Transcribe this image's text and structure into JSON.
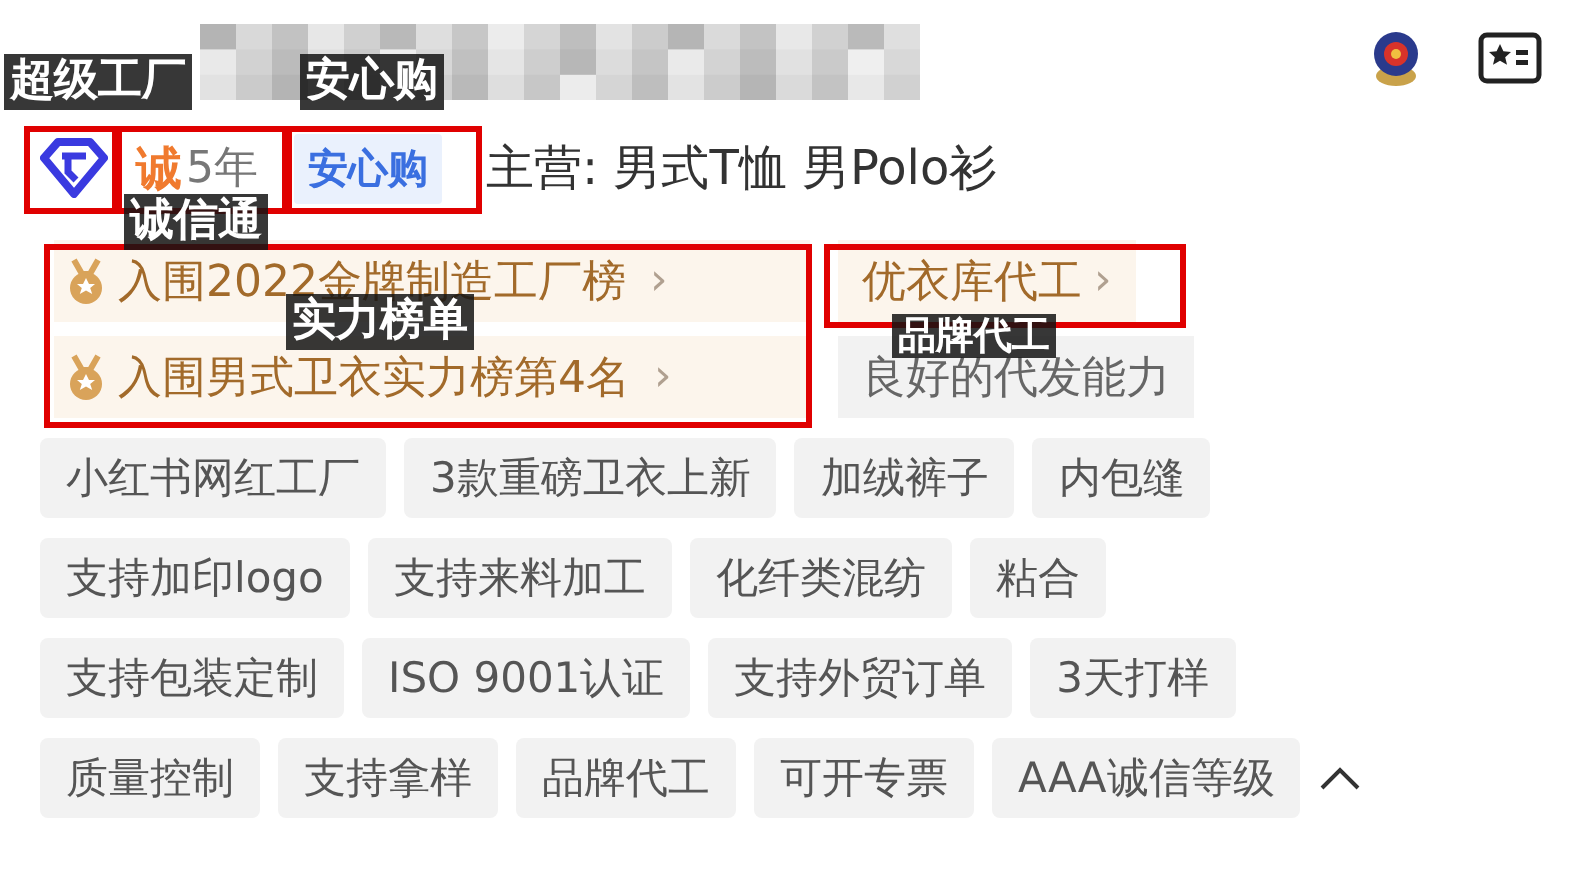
{
  "header": {
    "cheng": "诚",
    "years": "5年",
    "anxin": "安心购",
    "main_business": "主营: 男式T恤 男Polo衫"
  },
  "rankings": [
    {
      "label": "入围2022金牌制造工厂榜",
      "arrow": "›"
    },
    {
      "label": "入围男式卫衣实力榜第4名",
      "arrow": "›"
    }
  ],
  "side_tags": [
    {
      "label": "优衣库代工",
      "kind": "highlight",
      "arrow": "›"
    },
    {
      "label": "良好的代发能力",
      "kind": "plain"
    }
  ],
  "tag_rows": [
    [
      "小红书网红工厂",
      "3款重磅卫衣上新",
      "加绒裤子",
      "内包缝"
    ],
    [
      "支持加印logo",
      "支持来料加工",
      "化纤类混纺",
      "粘合"
    ],
    [
      "支持包装定制",
      "ISO 9001认证",
      "支持外贸订单",
      "3天打样"
    ],
    [
      "质量控制",
      "支持拿样",
      "品牌代工",
      "可开专票",
      "AAA诚信等级"
    ]
  ],
  "annotations": [
    {
      "text": "超级工厂"
    },
    {
      "text": "安心购"
    },
    {
      "text": "诚信通"
    },
    {
      "text": "实力榜单"
    },
    {
      "text": "品牌代工"
    }
  ]
}
